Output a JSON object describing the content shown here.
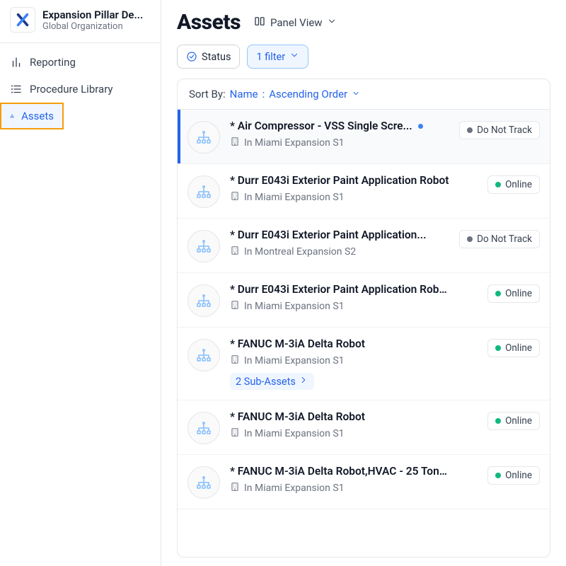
{
  "org": {
    "title": "Expansion Pillar De...",
    "subtitle": "Global Organization"
  },
  "nav": {
    "reporting": "Reporting",
    "procedure": "Procedure Library",
    "assets": "Assets"
  },
  "header": {
    "title": "Assets",
    "view_label": "Panel View"
  },
  "filters": {
    "status_label": "Status",
    "filter_label": "1 filter"
  },
  "sort": {
    "prefix": "Sort By:",
    "field": "Name",
    "sep": ":",
    "order": "Ascending Order"
  },
  "statuses": {
    "do_not_track": "Do Not Track",
    "online": "Online"
  },
  "assets": [
    {
      "title": "* Air Compressor - VSS Single Scre...",
      "location": "In Miami Expansion S1",
      "status": "do_not_track",
      "new_dot": true,
      "selected": true
    },
    {
      "title": "* Durr E043i Exterior Paint Application Robot",
      "location": "In Miami Expansion S1",
      "status": "online"
    },
    {
      "title": "* Durr E043i Exterior Paint Application...",
      "location": "In Montreal Expansion S2",
      "status": "do_not_track"
    },
    {
      "title": "* Durr E043i Exterior Paint Application Robot...",
      "location": "In Miami Expansion S1",
      "status": "online"
    },
    {
      "title": "* FANUC M-3iA Delta Robot",
      "location": "In Miami Expansion S1",
      "status": "online",
      "sub_assets": "2 Sub-Assets"
    },
    {
      "title": "* FANUC M-3iA Delta Robot",
      "location": "In Miami Expansion S1",
      "status": "online"
    },
    {
      "title": "* FANUC M-3iA Delta Robot,HVAC - 25 Ton ...",
      "location": "In Miami Expansion S1",
      "status": "online"
    }
  ]
}
